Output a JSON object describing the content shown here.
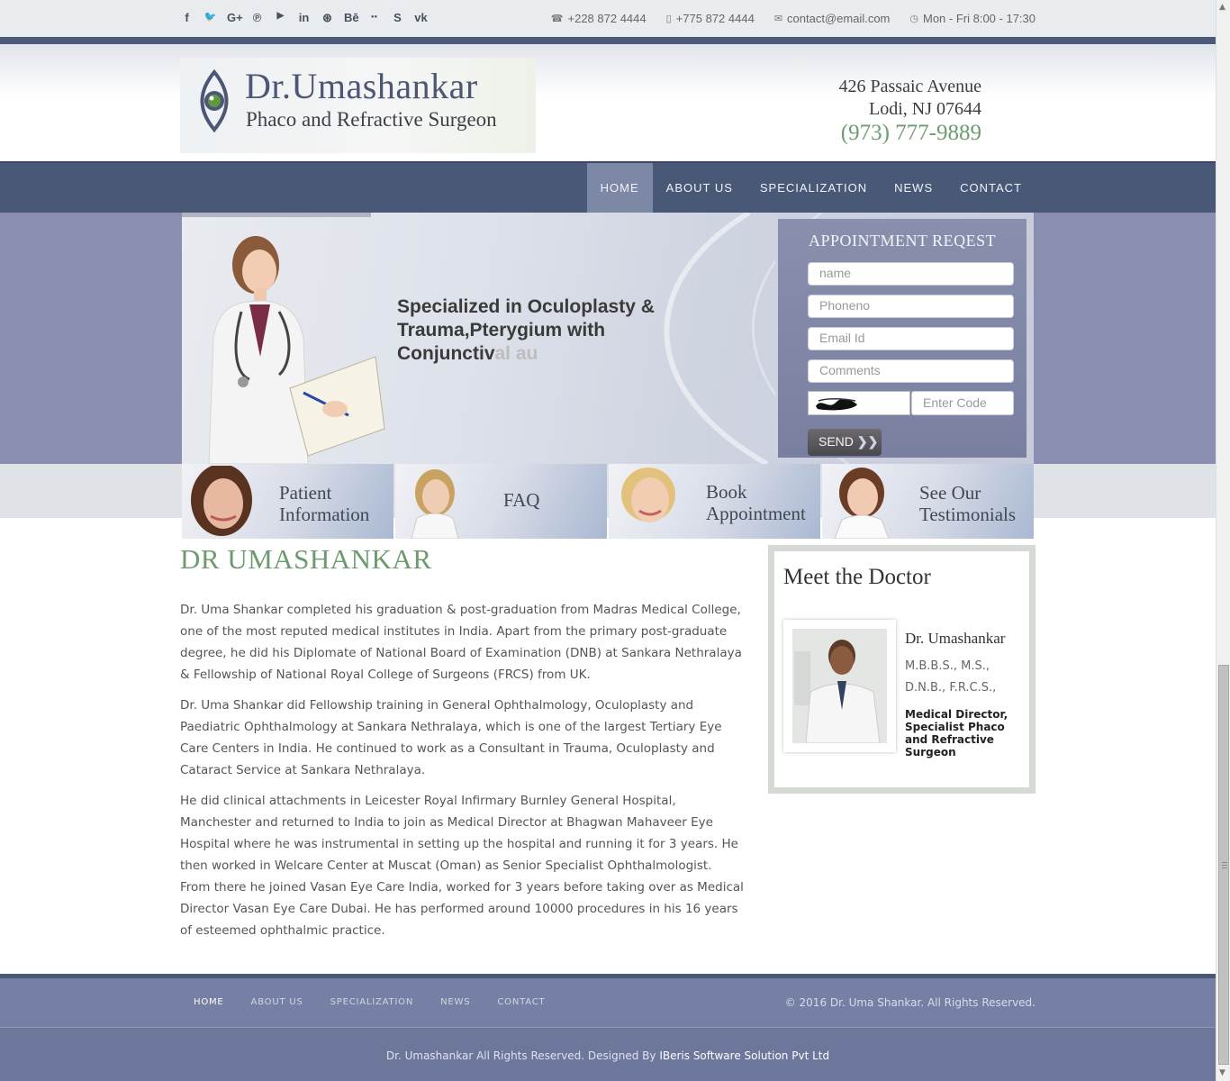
{
  "topbar": {
    "social": [
      {
        "icon": "facebook-icon",
        "glyph": "f"
      },
      {
        "icon": "twitter-icon",
        "glyph": "🐦"
      },
      {
        "icon": "google-plus-icon",
        "glyph": "G+"
      },
      {
        "icon": "pinterest-icon",
        "glyph": "℗"
      },
      {
        "icon": "youtube-icon",
        "glyph": "▶"
      },
      {
        "icon": "linkedin-icon",
        "glyph": "in"
      },
      {
        "icon": "dribbble-icon",
        "glyph": "⊛"
      },
      {
        "icon": "behance-icon",
        "glyph": "Bē"
      },
      {
        "icon": "flickr-icon",
        "glyph": "●●"
      },
      {
        "icon": "skype-icon",
        "glyph": "S"
      },
      {
        "icon": "vk-icon",
        "glyph": "vk"
      }
    ],
    "phone1": "+228 872 4444",
    "phone2": "+775 872 4444",
    "email": "contact@email.com",
    "hours": "Mon - Fri 8:00 - 17:30"
  },
  "header": {
    "logo_name": "Dr.Umashankar",
    "logo_sub": "Phaco and Refractive Surgeon",
    "address_line1": "426 Passaic Avenue",
    "address_line2": "Lodi, NJ 07644",
    "phone": "(973) 777-9889"
  },
  "nav": {
    "items": [
      "HOME",
      "ABOUT US",
      "SPECIALIZATION",
      "NEWS",
      "CONTACT"
    ],
    "active": "HOME"
  },
  "hero": {
    "text_main": "Specialized in Oculoplasty & Trauma,Pterygium with Conjunctiv",
    "text_faded": "al au"
  },
  "appointment": {
    "title": "APPOINTMENT REQEST",
    "name_placeholder": "name",
    "phone_placeholder": "Phoneno",
    "email_placeholder": "Email Id",
    "comments_placeholder": "Comments",
    "code_placeholder": "Enter Code",
    "send_label": "SEND"
  },
  "tiles": [
    {
      "label_line1": "Patient",
      "label_line2": "Information"
    },
    {
      "label_line1": "FAQ",
      "label_line2": ""
    },
    {
      "label_line1": "Book",
      "label_line2": "Appointment"
    },
    {
      "label_line1": "See Our",
      "label_line2": "Testimonials"
    }
  ],
  "main": {
    "title": "DR UMASHANKAR",
    "paragraphs": [
      "Dr. Uma Shankar completed his graduation & post-graduation from Madras Medical College, one of the most reputed medical institutes in India. Apart from the primary post-graduate degree, he did his Diplomate of National Board of Examination (DNB) at Sankara Nethralaya & Fellowship of National Royal College of Surgeons (FRCS) from UK.",
      "Dr. Uma Shankar did Fellowship training in General Ophthalmology, Oculoplasty and Paediatric Ophthalmology at Sankara Nethralaya, which is one of the largest Tertiary Eye Care Centers in India. He continued to work as a Consultant in Trauma, Oculoplasty and Cataract Service at Sankara Nethralaya.",
      "He did clinical attachments in Leicester Royal Infirmary Burnley General Hospital, Manchester and returned to India to join as Medical Director at Bhagwan Mahaveer Eye Hospital where he was instrumental in setting up the hospital and running it for 3 years. He then worked in Welcare Center at Muscat (Oman) as Senior Specialist Ophthalmologist. From there he joined Vasan Eye Care India, worked for 3 years before taking over as Medical Director Vasan Eye Care Dubai. He has performed around 10000 procedures in his 16 years of esteemed ophthalmic practice."
    ]
  },
  "meet": {
    "title": "Meet the Doctor",
    "name": "Dr. Umashankar",
    "credentials": "M.B.B.S., M.S., D.N.B., F.R.C.S.,",
    "role": "Medical Director, Specialist Phaco and Refractive Surgeon"
  },
  "footer": {
    "nav": [
      "HOME",
      "ABOUT US",
      "SPECIALIZATION",
      "NEWS",
      "CONTACT"
    ],
    "copyright": "© 2016 Dr. Uma Shankar. All Rights Reserved.",
    "bottom_text": "Dr. Umashankar All Rights Reserved. Designed By ",
    "company": "IBeris Software Solution Pvt Ltd"
  },
  "colors": {
    "nav_bg": "#4a5878",
    "accent_green": "#6d9a6f",
    "footer_bg": "#7580a4"
  }
}
